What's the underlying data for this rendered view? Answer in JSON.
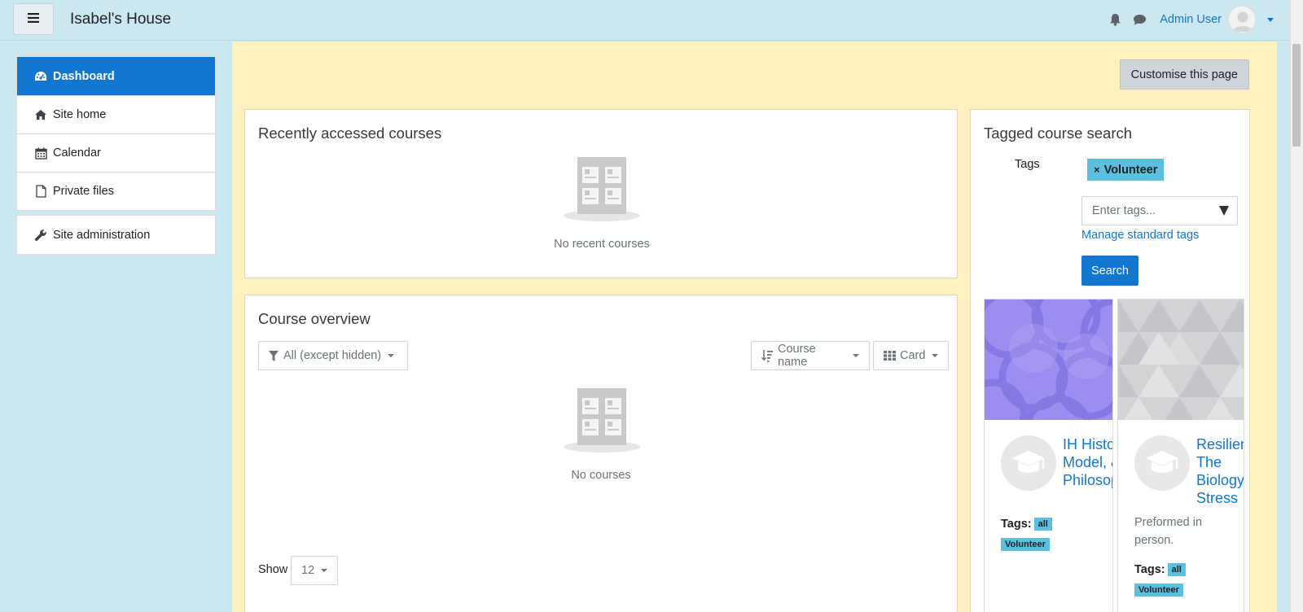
{
  "header": {
    "site_title": "Isabel's House",
    "user_name": "Admin User"
  },
  "sidebar": {
    "items": [
      {
        "label": "Dashboard",
        "icon": "dashboard-icon",
        "active": true
      },
      {
        "label": "Site home",
        "icon": "home-icon"
      },
      {
        "label": "Calendar",
        "icon": "calendar-icon"
      },
      {
        "label": "Private files",
        "icon": "file-icon"
      }
    ],
    "admin": {
      "label": "Site administration",
      "icon": "wrench-icon"
    }
  },
  "main": {
    "customise_label": "Customise this page",
    "recent": {
      "title": "Recently accessed courses",
      "empty_text": "No recent courses"
    },
    "overview": {
      "title": "Course overview",
      "filter_label": "All (except hidden)",
      "sort_label": "Course name",
      "view_label": "Card",
      "empty_text": "No courses",
      "show_label": "Show",
      "show_value": "12"
    },
    "tagged_search": {
      "title": "Tagged course search",
      "tags_label": "Tags",
      "selected_tag": "Volunteer",
      "input_placeholder": "Enter tags...",
      "manage_link": "Manage standard tags",
      "search_label": "Search",
      "courses": [
        {
          "name": "IH History,\nModel, &\nPhilosophy",
          "summary": "",
          "tags_label": "Tags:",
          "tags": [
            "all",
            "Volunteer"
          ]
        },
        {
          "name": "Resilience:\nThe\nBiology of\nStress",
          "summary": "Preformed in\nperson.",
          "tags_label": "Tags:",
          "tags": [
            "all",
            "Volunteer"
          ]
        }
      ]
    }
  },
  "colors": {
    "primary": "#1177d1",
    "navbar_bg": "#cbe8f0",
    "main_bg": "#fff0bf",
    "tag_bg": "#5bc0de"
  }
}
